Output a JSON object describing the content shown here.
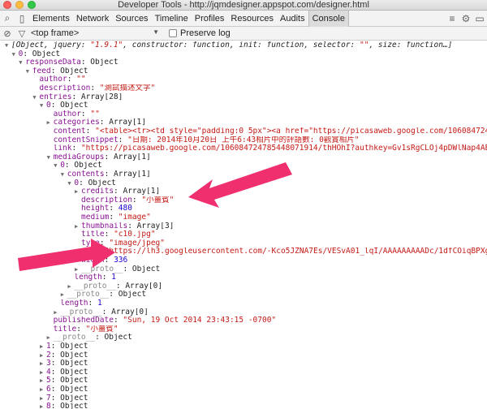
{
  "window": {
    "title": "Developer Tools - http://jqmdesigner.appspot.com/designer.html"
  },
  "tabs": [
    {
      "label": "Elements"
    },
    {
      "label": "Network"
    },
    {
      "label": "Sources"
    },
    {
      "label": "Timeline"
    },
    {
      "label": "Profiles"
    },
    {
      "label": "Resources"
    },
    {
      "label": "Audits"
    },
    {
      "label": "Console",
      "active": true
    }
  ],
  "filterbar": {
    "frame": "<top frame>",
    "preserve_log": "Preserve log"
  },
  "console_rows": [
    {
      "d": 0,
      "a": "▼",
      "parts": [
        [
          "it",
          "[Object, jquery: "
        ],
        [
          "s it",
          "\"1.9.1\""
        ],
        [
          "it",
          ", constructor: function, init: function, selector: "
        ],
        [
          "s it",
          "\"\""
        ],
        [
          "it",
          ", size: function…]"
        ]
      ]
    },
    {
      "d": 1,
      "a": "▼",
      "parts": [
        [
          "k",
          "0"
        ],
        [
          "o",
          ": Object"
        ]
      ]
    },
    {
      "d": 2,
      "a": "▼",
      "parts": [
        [
          "k",
          "responseData"
        ],
        [
          "o",
          ": Object"
        ]
      ]
    },
    {
      "d": 3,
      "a": "▼",
      "parts": [
        [
          "k",
          "feed"
        ],
        [
          "o",
          ": Object"
        ]
      ]
    },
    {
      "d": 4,
      "a": "",
      "parts": [
        [
          "k",
          "author"
        ],
        [
          "o",
          ": "
        ],
        [
          "s",
          "\"\""
        ]
      ]
    },
    {
      "d": 4,
      "a": "",
      "parts": [
        [
          "k",
          "description"
        ],
        [
          "o",
          ": "
        ],
        [
          "s",
          "\"測試描述文字\""
        ]
      ]
    },
    {
      "d": 4,
      "a": "▼",
      "parts": [
        [
          "k",
          "entries"
        ],
        [
          "o",
          ": Array[28]"
        ]
      ]
    },
    {
      "d": 5,
      "a": "▼",
      "parts": [
        [
          "k",
          "0"
        ],
        [
          "o",
          ": Object"
        ]
      ]
    },
    {
      "d": 6,
      "a": "",
      "parts": [
        [
          "k",
          "author"
        ],
        [
          "o",
          ": "
        ],
        [
          "s",
          "\"\""
        ]
      ]
    },
    {
      "d": 6,
      "a": "▶",
      "parts": [
        [
          "k",
          "categories"
        ],
        [
          "o",
          ": Array[1]"
        ]
      ]
    },
    {
      "d": 6,
      "a": "",
      "parts": [
        [
          "k",
          "content"
        ],
        [
          "o",
          ": "
        ],
        [
          "s",
          "\"<table><tr><td style=\"padding:0 5px\"><a href=\"https://picasaweb.google.com/1060847247"
        ]
      ]
    },
    {
      "d": 6,
      "a": "",
      "parts": [
        [
          "k",
          "contentSnippet"
        ],
        [
          "o",
          ": "
        ],
        [
          "s",
          "\"日期: 2014年10月20日 上午6:43相片中的評語數: 0觀賞相片\""
        ]
      ]
    },
    {
      "d": 6,
      "a": "",
      "parts": [
        [
          "k",
          "link"
        ],
        [
          "o",
          ": "
        ],
        [
          "s",
          "\"https://picasaweb.google.com/106084724785448071914/thHOhI?authkey=Gv1sRgCLOj4pDWlNap4AE#"
        ]
      ]
    },
    {
      "d": 6,
      "a": "▼",
      "parts": [
        [
          "k",
          "mediaGroups"
        ],
        [
          "o",
          ": Array[1]"
        ]
      ]
    },
    {
      "d": 7,
      "a": "▼",
      "parts": [
        [
          "k",
          "0"
        ],
        [
          "o",
          ": Object"
        ]
      ]
    },
    {
      "d": 8,
      "a": "▼",
      "parts": [
        [
          "k",
          "contents"
        ],
        [
          "o",
          ": Array[1]"
        ]
      ]
    },
    {
      "d": 9,
      "a": "▼",
      "parts": [
        [
          "k",
          "0"
        ],
        [
          "o",
          ": Object"
        ]
      ]
    },
    {
      "d": 10,
      "a": "▶",
      "parts": [
        [
          "k",
          "credits"
        ],
        [
          "o",
          ": Array[1]"
        ]
      ]
    },
    {
      "d": 10,
      "a": "",
      "parts": [
        [
          "k",
          "description"
        ],
        [
          "o",
          ": "
        ],
        [
          "s",
          "\"小薑賓\""
        ]
      ]
    },
    {
      "d": 10,
      "a": "",
      "parts": [
        [
          "k",
          "height"
        ],
        [
          "o",
          ": "
        ],
        [
          "n",
          "480"
        ]
      ]
    },
    {
      "d": 10,
      "a": "",
      "parts": [
        [
          "k",
          "medium"
        ],
        [
          "o",
          ": "
        ],
        [
          "s",
          "\"image\""
        ]
      ]
    },
    {
      "d": 10,
      "a": "▶",
      "parts": [
        [
          "k",
          "thumbnails"
        ],
        [
          "o",
          ": Array[3]"
        ]
      ]
    },
    {
      "d": 10,
      "a": "",
      "parts": [
        [
          "k",
          "title"
        ],
        [
          "o",
          ": "
        ],
        [
          "s",
          "\"c10.jpg\""
        ]
      ]
    },
    {
      "d": 10,
      "a": "",
      "parts": [
        [
          "k",
          "type"
        ],
        [
          "o",
          ": "
        ],
        [
          "s",
          "\"image/jpeg\""
        ]
      ]
    },
    {
      "d": 10,
      "a": "",
      "parts": [
        [
          "k",
          "url"
        ],
        [
          "o",
          ": "
        ],
        [
          "s",
          "\"https://lh3.googleusercontent.com/-Kco5JZNA7Es/VESvA01_lqI/AAAAAAAAADc/1dfCOiqBPXg"
        ]
      ]
    },
    {
      "d": 10,
      "a": "",
      "parts": [
        [
          "k",
          "width"
        ],
        [
          "o",
          ": "
        ],
        [
          "n",
          "336"
        ]
      ]
    },
    {
      "d": 10,
      "a": "▶",
      "parts": [
        [
          "dim",
          "__proto__"
        ],
        [
          "o",
          ": Object"
        ]
      ]
    },
    {
      "d": 9,
      "a": "",
      "parts": [
        [
          "k",
          "length"
        ],
        [
          "o",
          ": "
        ],
        [
          "n",
          "1"
        ]
      ]
    },
    {
      "d": 9,
      "a": "▶",
      "parts": [
        [
          "dim",
          "__proto__"
        ],
        [
          "o",
          ": Array[0]"
        ]
      ]
    },
    {
      "d": 8,
      "a": "▶",
      "parts": [
        [
          "dim",
          "__proto__"
        ],
        [
          "o",
          ": Object"
        ]
      ]
    },
    {
      "d": 7,
      "a": "",
      "parts": [
        [
          "k",
          "length"
        ],
        [
          "o",
          ": "
        ],
        [
          "n",
          "1"
        ]
      ]
    },
    {
      "d": 7,
      "a": "▶",
      "parts": [
        [
          "dim",
          "__proto__"
        ],
        [
          "o",
          ": Array[0]"
        ]
      ]
    },
    {
      "d": 6,
      "a": "",
      "parts": [
        [
          "k",
          "publishedDate"
        ],
        [
          "o",
          ": "
        ],
        [
          "s",
          "\"Sun, 19 Oct 2014 23:43:15 -0700\""
        ]
      ]
    },
    {
      "d": 6,
      "a": "",
      "parts": [
        [
          "k",
          "title"
        ],
        [
          "o",
          ": "
        ],
        [
          "s",
          "\"小薑賓\""
        ]
      ]
    },
    {
      "d": 6,
      "a": "▶",
      "parts": [
        [
          "dim",
          "__proto__"
        ],
        [
          "o",
          ": Object"
        ]
      ]
    },
    {
      "d": 5,
      "a": "▶",
      "parts": [
        [
          "k",
          "1"
        ],
        [
          "o",
          ": Object"
        ]
      ]
    },
    {
      "d": 5,
      "a": "▶",
      "parts": [
        [
          "k",
          "2"
        ],
        [
          "o",
          ": Object"
        ]
      ]
    },
    {
      "d": 5,
      "a": "▶",
      "parts": [
        [
          "k",
          "3"
        ],
        [
          "o",
          ": Object"
        ]
      ]
    },
    {
      "d": 5,
      "a": "▶",
      "parts": [
        [
          "k",
          "4"
        ],
        [
          "o",
          ": Object"
        ]
      ]
    },
    {
      "d": 5,
      "a": "▶",
      "parts": [
        [
          "k",
          "5"
        ],
        [
          "o",
          ": Object"
        ]
      ]
    },
    {
      "d": 5,
      "a": "▶",
      "parts": [
        [
          "k",
          "6"
        ],
        [
          "o",
          ": Object"
        ]
      ]
    },
    {
      "d": 5,
      "a": "▶",
      "parts": [
        [
          "k",
          "7"
        ],
        [
          "o",
          ": Object"
        ]
      ]
    },
    {
      "d": 5,
      "a": "▶",
      "parts": [
        [
          "k",
          "8"
        ],
        [
          "o",
          ": Object"
        ]
      ]
    }
  ],
  "annotation": {
    "color": "#f0306e"
  }
}
